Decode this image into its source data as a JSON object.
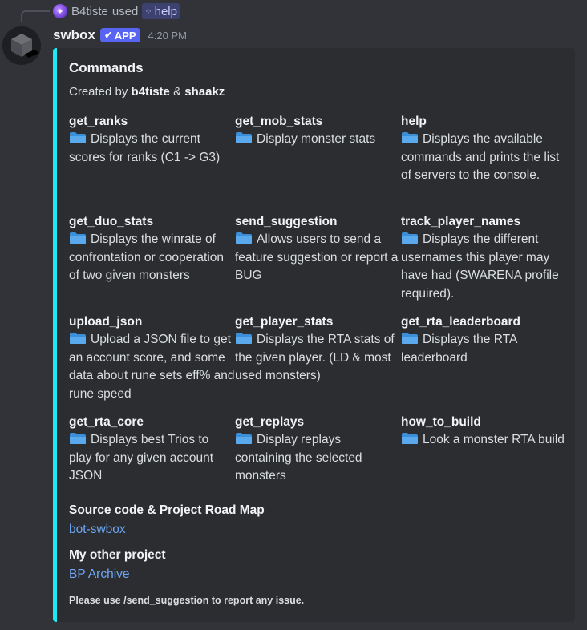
{
  "reply": {
    "user": "B4tiste",
    "action": "used",
    "command": "help"
  },
  "message": {
    "username": "swbox",
    "badge": "APP",
    "timestamp": "4:20 PM"
  },
  "embed": {
    "accent_color": "#1de9f2",
    "title": "Commands",
    "created_by_prefix": "Created by",
    "author1": "b4tiste",
    "and": "&",
    "author2": "shaakz",
    "commands": [
      {
        "name": "get_ranks",
        "description": "Displays the current scores for ranks (C1 -> G3)"
      },
      {
        "name": "get_mob_stats",
        "description": "Display monster stats"
      },
      {
        "name": "help",
        "description": "Displays the available commands and prints the list of servers to the console."
      },
      {
        "name": "get_duo_stats",
        "description": "Displays the winrate of confrontation or cooperation of two given monsters"
      },
      {
        "name": "send_suggestion",
        "description": "Allows users to send a feature suggestion or report a BUG"
      },
      {
        "name": "track_player_names",
        "description": "Displays the different usernames this player may have had (SWARENA profile required)."
      },
      {
        "name": "upload_json",
        "description": "Upload a JSON file to get an account score, and some data about rune sets eff% and rune speed"
      },
      {
        "name": "get_player_stats",
        "description": "Displays the RTA stats of the given player. (LD & most used monsters)"
      },
      {
        "name": "get_rta_leaderboard",
        "description": "Displays the RTA leaderboard"
      },
      {
        "name": "get_rta_core",
        "description": "Displays best Trios to play for any given account JSON"
      },
      {
        "name": "get_replays",
        "description": "Display replays containing the selected monsters"
      },
      {
        "name": "how_to_build",
        "description": "Look a monster RTA build"
      }
    ],
    "source_title": "Source code & Project Road Map",
    "source_link": "bot-swbox",
    "other_title": "My other project",
    "other_link": "BP Archive",
    "footer": "Please use /send_suggestion to report any issue."
  }
}
